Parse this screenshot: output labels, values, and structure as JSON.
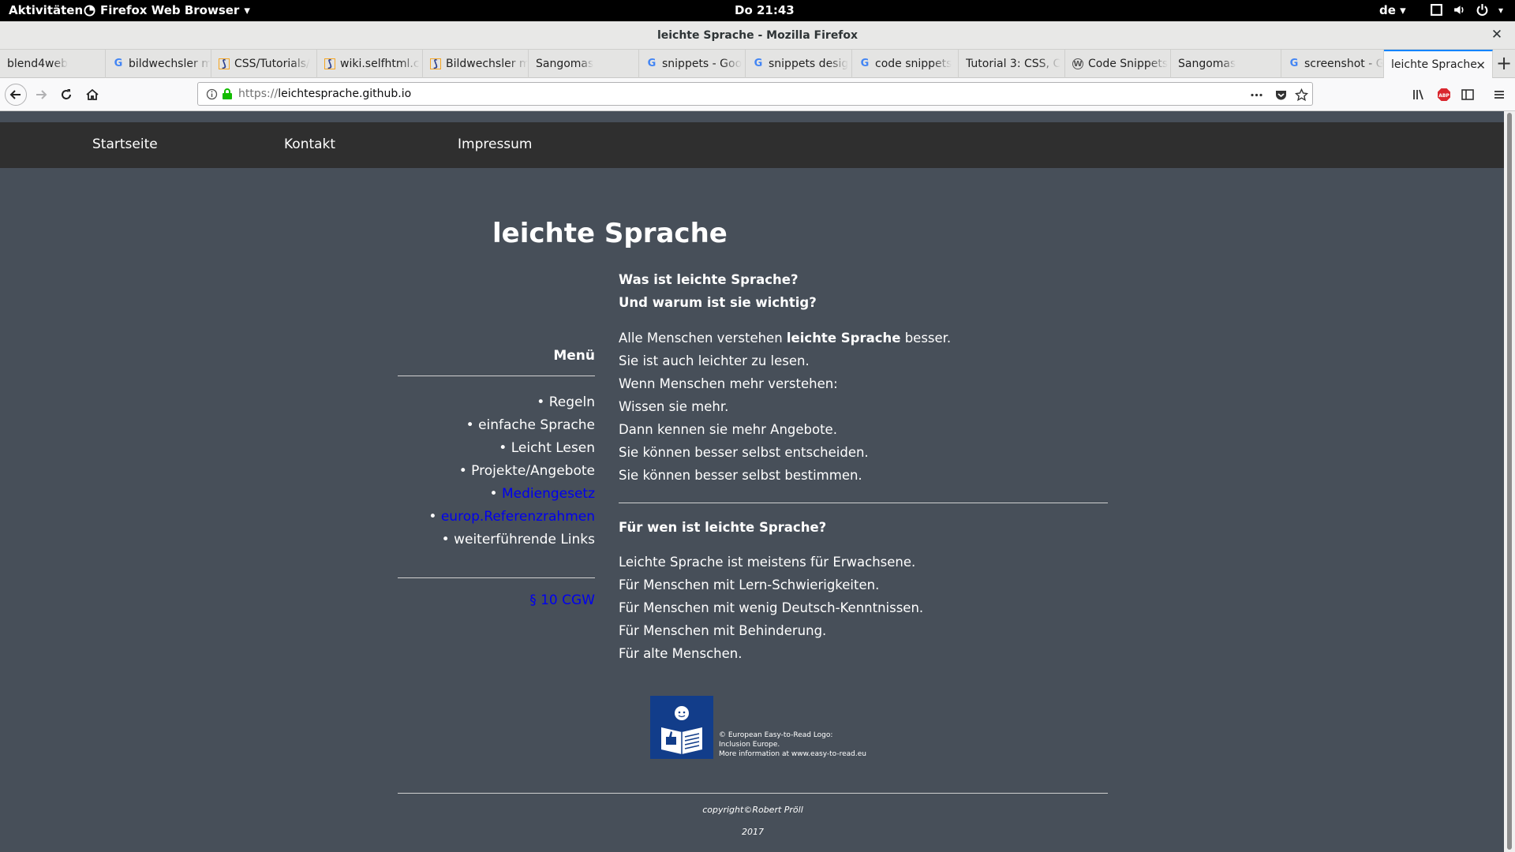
{
  "system_bar": {
    "activities": "Aktivitäten",
    "app_name": "Firefox Web Browser",
    "clock": "Do 21:43",
    "language": "de"
  },
  "window": {
    "title": "leichte Sprache - Mozilla Firefox"
  },
  "tabs": [
    {
      "label": "blend4web",
      "icon": "none"
    },
    {
      "label": "bildwechsler m",
      "icon": "google-icon"
    },
    {
      "label": "CSS/Tutorials/",
      "icon": "selfhtml-icon"
    },
    {
      "label": "wiki.selfhtml.c",
      "icon": "selfhtml-icon"
    },
    {
      "label": "Bildwechsler m",
      "icon": "selfhtml-icon"
    },
    {
      "label": "Sangomas",
      "icon": "none"
    },
    {
      "label": "snippets - Goo",
      "icon": "google-icon"
    },
    {
      "label": "snippets desig",
      "icon": "google-icon"
    },
    {
      "label": "code snippets",
      "icon": "google-icon"
    },
    {
      "label": "Tutorial 3: CSS, C",
      "icon": "none"
    },
    {
      "label": "Code Snippets",
      "icon": "wordpress-icon"
    },
    {
      "label": "Sangomas",
      "icon": "none"
    },
    {
      "label": "screenshot - G",
      "icon": "google-icon"
    },
    {
      "label": "leichte Sprache",
      "icon": "none",
      "active": true
    }
  ],
  "urlbar": {
    "url_prefix": "https://",
    "url_host": "leichtesprache.github.io"
  },
  "site": {
    "nav": [
      "Startseite",
      "Kontakt",
      "Impressum"
    ],
    "title": "leichte Sprache",
    "menu_title": "Menü",
    "menu_items": [
      {
        "label": "Regeln",
        "link": false
      },
      {
        "label": "einfache Sprache",
        "link": false
      },
      {
        "label": "Leicht Lesen",
        "link": false
      },
      {
        "label": "Projekte/Angebote",
        "link": false
      },
      {
        "label": "Mediengesetz",
        "link": true
      },
      {
        "label": "europ.Referenzrahmen",
        "link": true
      },
      {
        "label": "weiterführende Links",
        "link": false
      }
    ],
    "bullet": "•",
    "cgw_link": "§ 10 CGW",
    "section1": {
      "heading_line1": "Was ist leichte Sprache?",
      "heading_line2": "Und warum ist sie wichtig?",
      "intro_before": "Alle Menschen verstehen ",
      "intro_bold": "leichte Sprache",
      "intro_after": " besser.",
      "lines": [
        "Sie ist auch leichter zu lesen.",
        "Wenn Menschen mehr verstehen:",
        "Wissen sie mehr.",
        "Dann kennen sie mehr Angebote.",
        "Sie können besser selbst entscheiden.",
        "Sie können besser selbst bestimmen."
      ]
    },
    "section2": {
      "heading": "Für wen ist leichte Sprache?",
      "lines": [
        "Leichte Sprache ist meistens für Erwachsene.",
        "Für Menschen mit Lern-Schwierigkeiten.",
        "Für Menschen mit wenig Deutsch-Kenntnissen.",
        "Für Menschen mit Behinderung.",
        "Für alte Menschen."
      ]
    },
    "logo_credit": [
      "© European Easy-to-Read Logo:",
      "Inclusion Europe.",
      "More information at www.easy-to-read.eu"
    ],
    "copyright": "copyright©Robert Pröll",
    "year": "2017"
  },
  "colors": {
    "page_bg": "#474f59",
    "nav_bg": "#2f2f2f",
    "link": "#0000ee",
    "logo_bg": "#123d8a",
    "tab_accent": "#0a84ff"
  }
}
